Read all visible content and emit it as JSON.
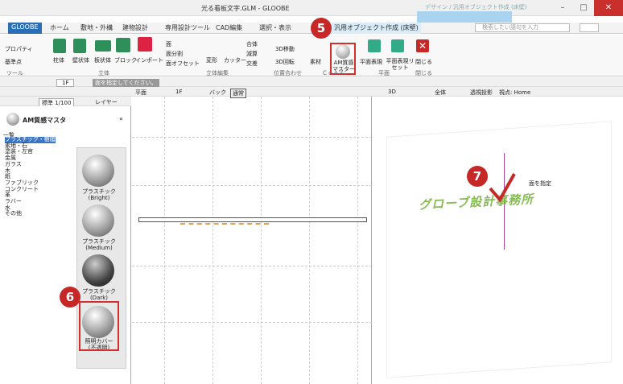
{
  "window": {
    "title": "光る看板文字.GLM - GLOOBE",
    "ctx_label": "デザイン / 汎用オブジェクト作成 (床壁)",
    "min": "–",
    "max": "□",
    "close": "✕"
  },
  "tabs": [
    "GLOOBE",
    "ホーム",
    "敷地・外構",
    "建物設計",
    "専用設計ツール",
    "CAD編集",
    "選択・表示",
    "汎用オブジェクト作成 (床壁)"
  ],
  "search": {
    "placeholder": "検索したい語句を入力"
  },
  "ribbon": {
    "tool": [
      "プロパティ",
      "基準点"
    ],
    "solid": [
      "柱体",
      "壁状体",
      "板状体",
      "ブロック",
      "インポート"
    ],
    "face": [
      "面",
      "面分割",
      "面オフセット"
    ],
    "edit": [
      "変形",
      "カッター",
      "合体",
      "減算",
      "交差"
    ],
    "align": [
      "3D移動",
      "3D回転"
    ],
    "mat": [
      "素材",
      "AM質感マスター"
    ],
    "plan": [
      "平面表現",
      "平面表現リセット"
    ],
    "close": "閉じる",
    "groups": [
      "ツール",
      "立体",
      "立体編集",
      "位置合わせ",
      "Ｃｏｎｔ",
      "平面",
      "閉じる"
    ]
  },
  "toolbar": {
    "floor": "1F",
    "hint": "面を指定してください。",
    "scale": "標準 1/100",
    "layer": "レイヤー",
    "plan_tab": "平面",
    "plan_floor": "1F",
    "back": "バック",
    "normal": "通常",
    "view3d": "3D",
    "all": "全体",
    "proj": "透視投影",
    "viewpoint": "視点: Home"
  },
  "panel": {
    "title": "AM質感マスタ",
    "list_label": "一覧",
    "items": [
      "プラスチック・樹脂",
      "素地・石",
      "塗装・左官",
      "金属",
      "ガラス",
      "木",
      "紙",
      "ファブリック",
      "コンクリート",
      "革",
      "ラバー",
      "水",
      "その他"
    ],
    "thumbs": [
      "プラスチック\n(Bright)",
      "プラスチック\n(Medium)",
      "プラスチック\n(Dark)",
      "照明カバー\n(不透明)"
    ]
  },
  "view": {
    "sign": "グローブ設計事務所",
    "hint": "面を指定"
  },
  "badges": [
    "5",
    "6",
    "7"
  ],
  "colors": {
    "accent": "#2a6fb5",
    "badge": "#c62828",
    "highlight": "#d32f2f"
  }
}
